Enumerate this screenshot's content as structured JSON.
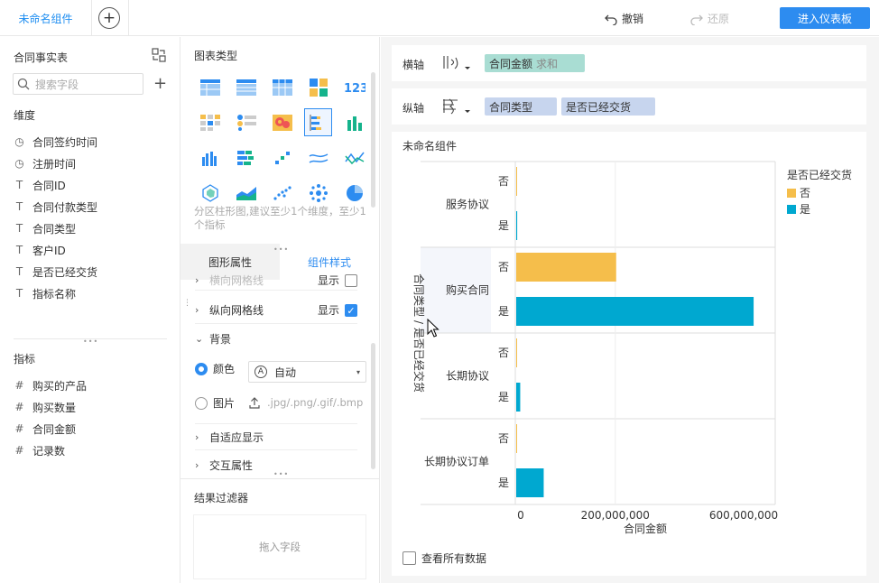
{
  "topbar": {
    "tab_title": "未命名组件",
    "add_tab": "+",
    "undo_label": "撤销",
    "redo_label": "还原",
    "enter_dashboard": "进入仪表板"
  },
  "left_panel": {
    "fact_title": "合同事实表",
    "search_placeholder": "搜索字段",
    "dimensions_title": "维度",
    "dimensions": [
      {
        "icon": "clock-icon",
        "label": "合同签约时间"
      },
      {
        "icon": "clock-icon",
        "label": "注册时间"
      },
      {
        "icon": "text-icon",
        "label": "合同ID"
      },
      {
        "icon": "text-icon",
        "label": "合同付款类型"
      },
      {
        "icon": "text-icon",
        "label": "合同类型"
      },
      {
        "icon": "text-icon",
        "label": "客户ID"
      },
      {
        "icon": "text-icon",
        "label": "是否已经交货"
      },
      {
        "icon": "text-icon",
        "label": "指标名称"
      }
    ],
    "measures_title": "指标",
    "measures": [
      {
        "icon": "hash-icon",
        "label": "购买的产品"
      },
      {
        "icon": "hash-icon",
        "label": "购买数量"
      },
      {
        "icon": "hash-icon",
        "label": "合同金额"
      },
      {
        "icon": "hash-icon",
        "label": "记录数"
      }
    ]
  },
  "middle_panel": {
    "chart_type_title": "图表类型",
    "hint": "分区柱形图,建议至少1个维度，至少1个指标",
    "tab_graph_props": "图形属性",
    "tab_component_style": "组件样式",
    "row_h_grid": "横向网格线",
    "row_h_grid_toggle": "显示",
    "row_v_grid": "纵向网格线",
    "row_v_grid_toggle": "显示",
    "row_background": "背景",
    "color_label": "颜色",
    "color_value": "自动",
    "image_label": "图片",
    "image_formats": ".jpg/.png/.gif/.bmp",
    "row_adaptive": "自适应显示",
    "row_interaction": "交互属性",
    "result_filter_title": "结果过滤器",
    "drop_field": "拖入字段"
  },
  "axes": {
    "x_label": "横轴",
    "x_pill_field": "合同金额",
    "x_pill_agg": "求和",
    "y_label": "纵轴",
    "y_pills": [
      "合同类型",
      "是否已经交货"
    ]
  },
  "chart_data": {
    "type": "bar",
    "title": "未命名组件",
    "orientation": "horizontal",
    "groups": [
      "服务协议",
      "购买合同",
      "长期协议",
      "长期协议订单"
    ],
    "subcategories": [
      "否",
      "是"
    ],
    "series": [
      {
        "name": "否",
        "color": "#f5be4b",
        "values": [
          0,
          200000000,
          0,
          0
        ]
      },
      {
        "name": "是",
        "color": "#00a8d0",
        "values": [
          2000000,
          475000000,
          8000000,
          55000000
        ]
      }
    ],
    "xlabel": "合同金额",
    "ylabel": "合同类型 / 是否已经交货",
    "x_ticks": [
      "0",
      "200,000,000",
      "600,000,000"
    ],
    "x_tick_values": [
      0,
      200000000,
      600000000
    ],
    "xlim": [
      0,
      520000000
    ],
    "legend_title": "是否已经交货",
    "legend_position": "right"
  },
  "footer": {
    "view_all": "查看所有数据"
  }
}
